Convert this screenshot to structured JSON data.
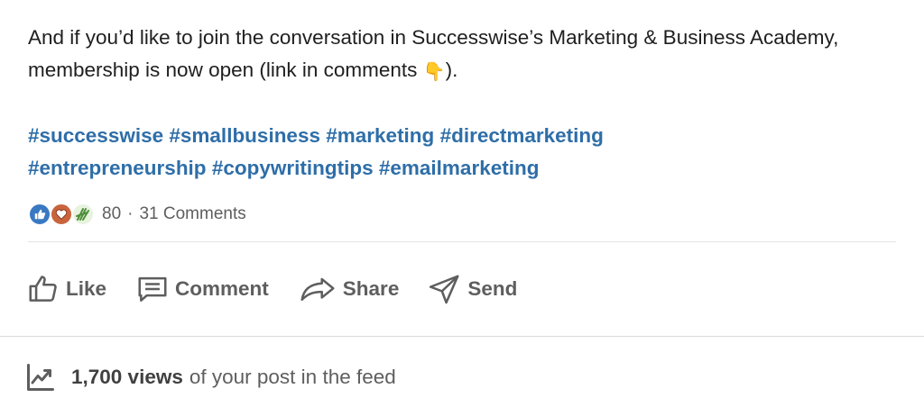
{
  "post": {
    "body_text": "And if you’d like to join the conversation in Successwise’s Marketing & Business Academy, membership is now open (link in comments ",
    "body_emoji": "👇",
    "body_suffix": ").",
    "hashtags": [
      "#successwise",
      "#smallbusiness",
      "#marketing",
      "#directmarketing",
      "#entrepreneurship",
      "#copywritingtips",
      "#emailmarketing"
    ]
  },
  "social": {
    "reactions": [
      "like-reaction",
      "love-reaction",
      "celebrate-reaction"
    ],
    "reaction_count": "80",
    "separator": "·",
    "comments_count": "31 Comments"
  },
  "actions": {
    "like_label": "Like",
    "comment_label": "Comment",
    "share_label": "Share",
    "send_label": "Send"
  },
  "views": {
    "count_label": "1,700 views",
    "suffix": "of your post in the feed"
  },
  "colors": {
    "hashtag": "#2e6ea8",
    "like_reaction": "#3a78c2",
    "love_reaction": "#c9643c",
    "celebrate_reaction": "#4f8f3a",
    "muted_text": "#5e5e5e"
  }
}
